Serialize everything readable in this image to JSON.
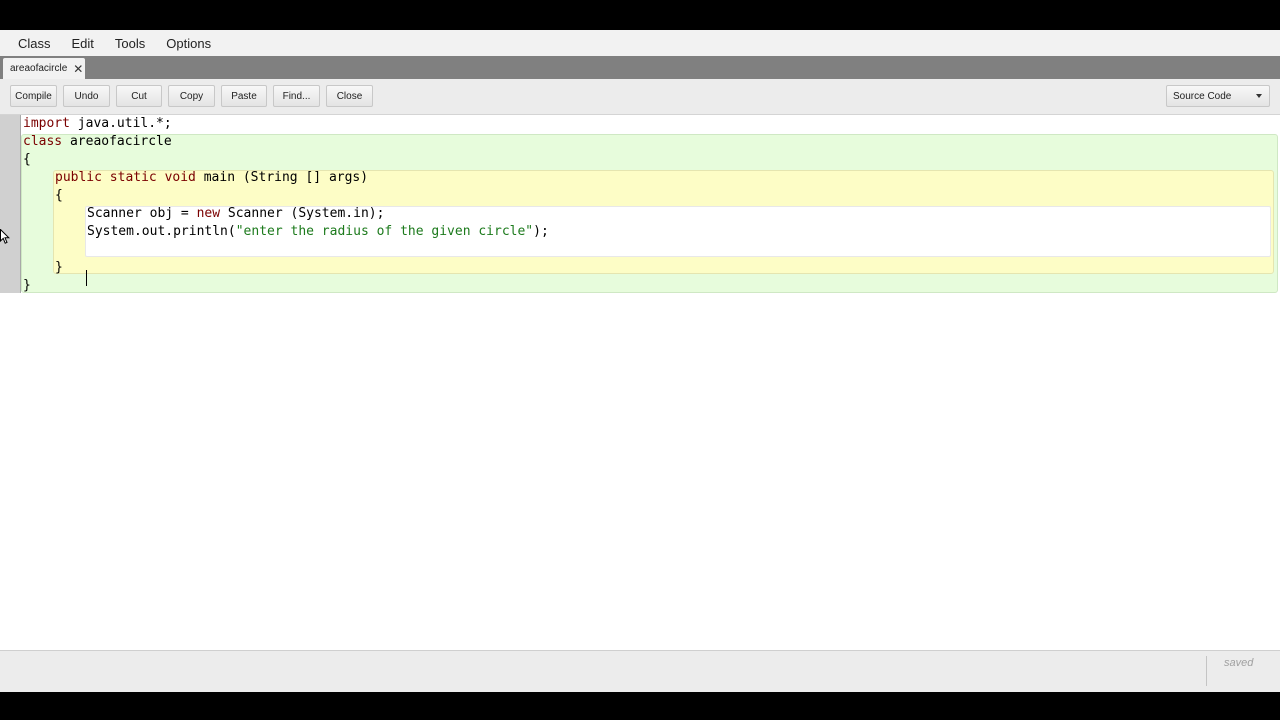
{
  "menu": {
    "items": [
      "Class",
      "Edit",
      "Tools",
      "Options"
    ]
  },
  "tab": {
    "label": "areaofacircle",
    "close_glyph": "✕"
  },
  "toolbar": {
    "compile": "Compile",
    "undo": "Undo",
    "cut": "Cut",
    "copy": "Copy",
    "paste": "Paste",
    "find": "Find...",
    "close": "Close",
    "view_mode": "Source Code"
  },
  "code": {
    "line1_kw": "import",
    "line1_rest": " java.util.*;",
    "line2_kw": "class",
    "line2_rest": " areaofacircle",
    "line3": "{",
    "line4_kw": "public static void",
    "line4_rest": " main (String [] args)",
    "line5": "{",
    "line6_a": "Scanner obj = ",
    "line6_kw": "new",
    "line6_b": " Scanner (System.in);",
    "line7_a": "System.out.println(",
    "line7_str": "\"enter the radius of the given circle\"",
    "line7_b": ");",
    "line9": "}",
    "line10": "}"
  },
  "status": {
    "text": "saved"
  },
  "colors": {
    "keyword": "#7a0000",
    "string": "#1c7a1c",
    "class_scope": "#e7fcdc",
    "method_scope": "#fdfdc6"
  },
  "icons": [
    "close-icon",
    "dropdown-caret-icon",
    "mouse-pointer-icon"
  ]
}
